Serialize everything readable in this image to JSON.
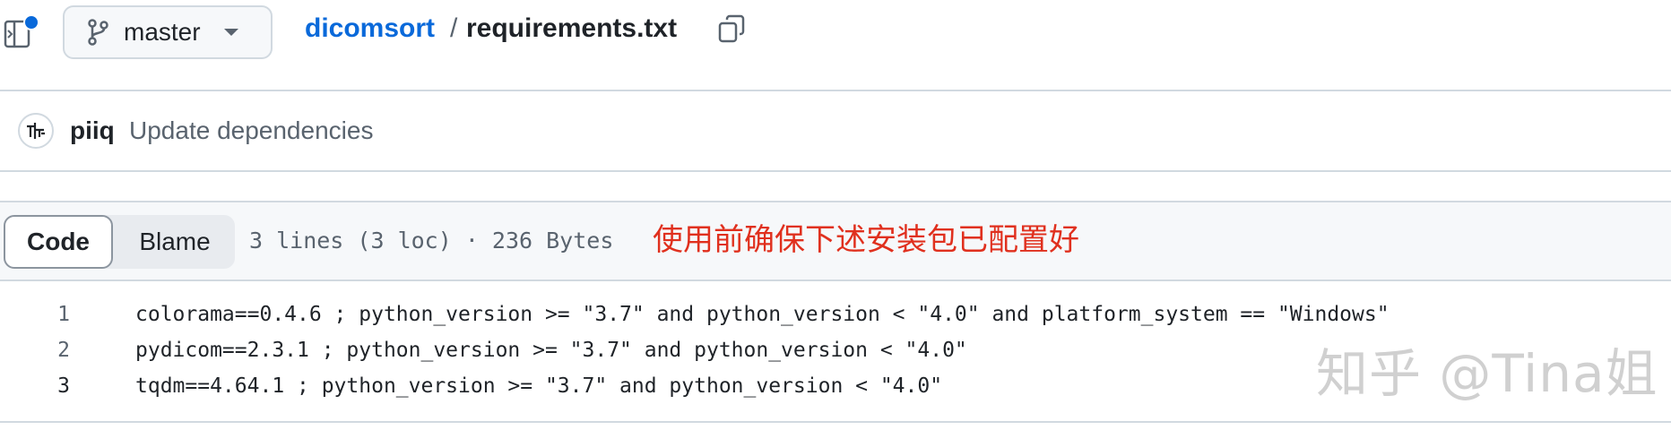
{
  "header": {
    "branch": "master",
    "repo": "dicomsort",
    "separator": "/",
    "file": "requirements.txt"
  },
  "commit": {
    "author": "piiq",
    "message": "Update dependencies"
  },
  "toolbar": {
    "code_label": "Code",
    "blame_label": "Blame",
    "file_info": "3 lines (3 loc) · 236 Bytes"
  },
  "annotation": "使用前确保下述安装包已配置好",
  "code": {
    "lines": [
      {
        "num": "1",
        "text": "colorama==0.4.6 ; python_version >= \"3.7\" and python_version < \"4.0\" and platform_system == \"Windows\""
      },
      {
        "num": "2",
        "text": "pydicom==2.3.1 ; python_version >= \"3.7\" and python_version < \"4.0\""
      },
      {
        "num": "3",
        "text": "tqdm==4.64.1 ; python_version >= \"3.7\" and python_version < \"4.0\""
      }
    ]
  },
  "watermark": "知乎 @Tina姐",
  "colors": {
    "link": "#0969da",
    "annotation": "#e0301e",
    "border": "#d1d9e0"
  }
}
